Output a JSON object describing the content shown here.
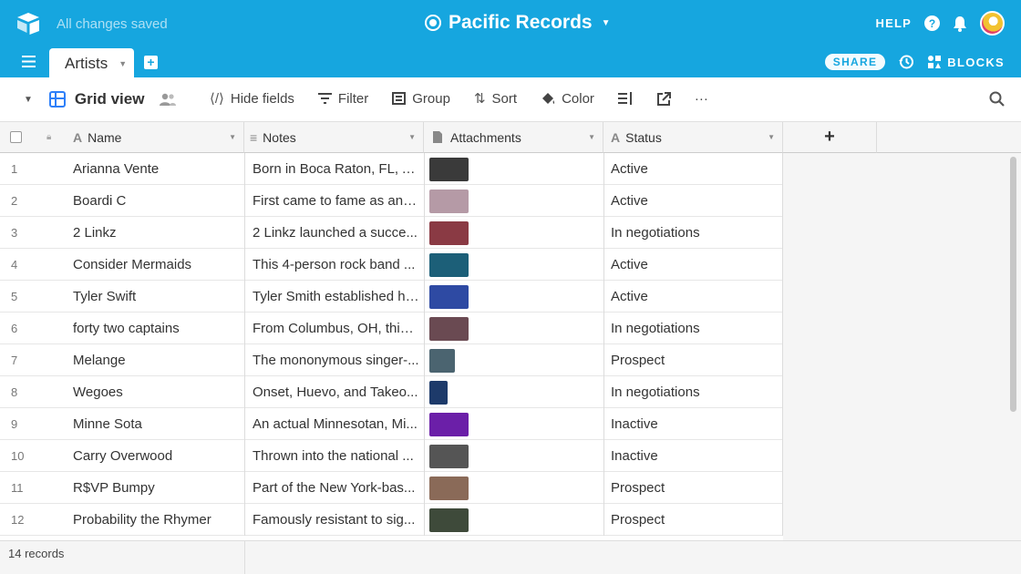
{
  "header": {
    "save_status": "All changes saved",
    "base_name": "Pacific Records",
    "help_label": "HELP",
    "help_symbol": "?"
  },
  "tabs": {
    "active_label": "Artists",
    "share_label": "SHARE",
    "blocks_label": "BLOCKS"
  },
  "toolbar": {
    "view_name": "Grid view",
    "hide_fields": "Hide fields",
    "filter": "Filter",
    "group": "Group",
    "sort": "Sort",
    "color": "Color",
    "more": "···"
  },
  "columns": {
    "name": "Name",
    "notes": "Notes",
    "attachments": "Attachments",
    "status": "Status",
    "add": "+"
  },
  "rows": [
    {
      "num": "1",
      "name": "Arianna Vente",
      "notes": "Born in Boca Raton, FL, A...",
      "status": "Active",
      "thumb": "#3a3a3a"
    },
    {
      "num": "2",
      "name": "Boardi C",
      "notes": "First came to fame as an i...",
      "status": "Active",
      "thumb": "#b59aa6"
    },
    {
      "num": "3",
      "name": "2 Linkz",
      "notes": "2 Linkz launched a succe...",
      "status": "In negotiations",
      "thumb": "#8a3a44"
    },
    {
      "num": "4",
      "name": "Consider Mermaids",
      "notes": "This 4-person rock band ...",
      "status": "Active",
      "thumb": "#1c5f78"
    },
    {
      "num": "5",
      "name": "Tyler Swift",
      "notes": "Tyler Smith established hi...",
      "status": "Active",
      "thumb": "#2e4aa3"
    },
    {
      "num": "6",
      "name": "forty two captains",
      "notes": "From Columbus, OH, this ...",
      "status": "In negotiations",
      "thumb": "#6a4a52"
    },
    {
      "num": "7",
      "name": "Melange",
      "notes": "The mononymous singer-...",
      "status": "Prospect",
      "thumb": "#4b6470"
    },
    {
      "num": "8",
      "name": "Wegoes",
      "notes": "Onset, Huevo, and Takeo...",
      "status": "In negotiations",
      "thumb": "#1d3a6a"
    },
    {
      "num": "9",
      "name": "Minne Sota",
      "notes": "An actual Minnesotan, Mi...",
      "status": "Inactive",
      "thumb": "#6b1fa8"
    },
    {
      "num": "10",
      "name": "Carry Overwood",
      "notes": "Thrown into the national ...",
      "status": "Inactive",
      "thumb": "#555555"
    },
    {
      "num": "11",
      "name": "R$VP Bumpy",
      "notes": "Part of the New York-bas...",
      "status": "Prospect",
      "thumb": "#8a6a58"
    },
    {
      "num": "12",
      "name": "Probability the Rhymer",
      "notes": "Famously resistant to sig...",
      "status": "Prospect",
      "thumb": "#3e4a3a"
    }
  ],
  "footer": {
    "record_count": "14 records"
  },
  "colors": {
    "brand": "#16a6df",
    "view_icon": "#2d7ff9"
  }
}
